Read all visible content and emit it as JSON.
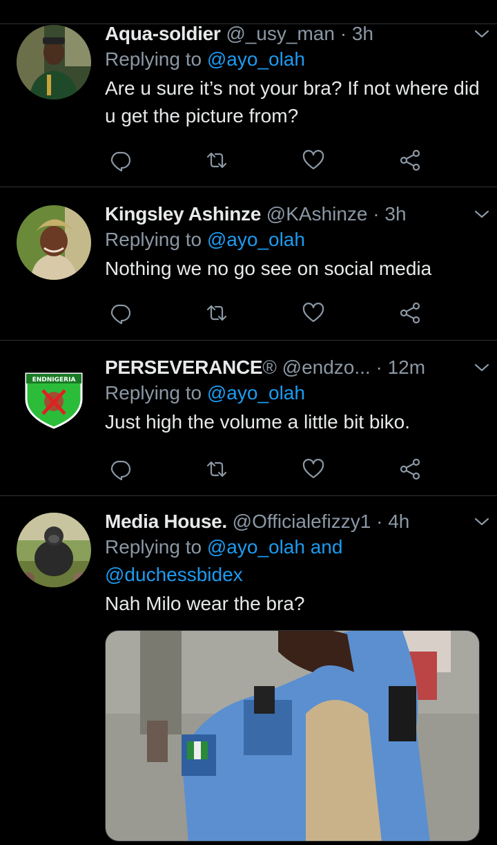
{
  "tweets": [
    {
      "name": "Aqua-soldier",
      "handle": "@_usy_man",
      "sep": "·",
      "time": "3h",
      "reply_prefix": "Replying to ",
      "reply_to": "@ayo_olah",
      "text": "Are u sure it’s not your bra? If not where did u get the picture from?",
      "avatar_desc": "man in green uniform"
    },
    {
      "name": "Kingsley Ashinze",
      "handle": "@KAshinze",
      "sep": "·",
      "time": "3h",
      "reply_prefix": "Replying to ",
      "reply_to": "@ayo_olah",
      "text": "Nothing we no go see on social media",
      "avatar_desc": "woman with headwrap"
    },
    {
      "name": "PERSEVERANCE",
      "name_badge": "®",
      "handle": "@endzo...",
      "sep": "·",
      "time": "12m",
      "reply_prefix": "Replying to ",
      "reply_to": "@ayo_olah",
      "text": "Just high the volume a little bit biko.",
      "avatar_desc": "green shield logo",
      "avatar_logo_text": "ENDNIGERIA"
    },
    {
      "name": "Media House.",
      "handle": "@Officialefizzy1",
      "sep": "·",
      "time": "4h",
      "reply_prefix": "Replying to ",
      "reply_to": "@ayo_olah and",
      "reply_to_2": "@duchessbidex",
      "text": "Nah Milo wear the bra?",
      "avatar_desc": "gorilla"
    }
  ],
  "colors": {
    "background": "#000000",
    "text": "#e7e9ea",
    "muted": "#8b98a5",
    "link": "#1d9bf0",
    "divider": "#2f3336"
  },
  "icons": [
    "reply-icon",
    "retweet-icon",
    "like-icon",
    "share-icon",
    "chevron-down-icon"
  ]
}
